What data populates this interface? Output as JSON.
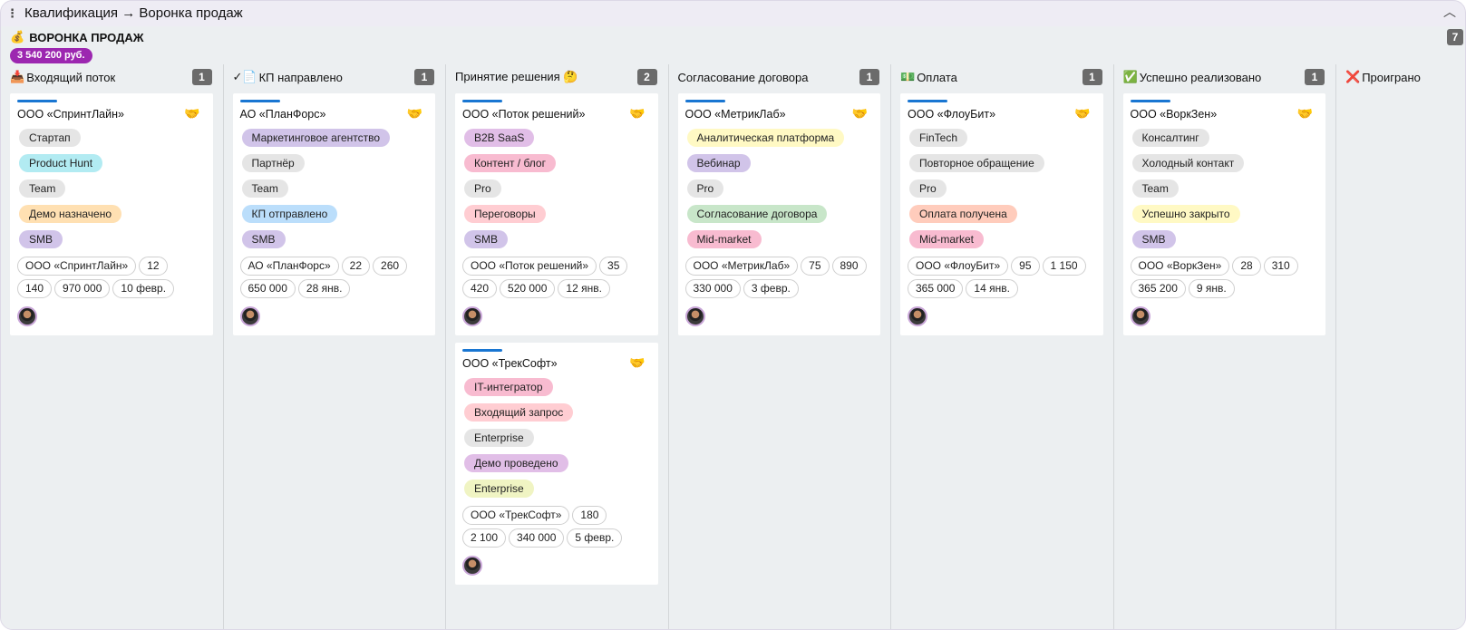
{
  "breadcrumb": "Квалификация → Воронка продаж",
  "board": {
    "icon": "money-bag-icon",
    "title": "ВОРОНКА ПРОДАЖ",
    "total": "3 540 200 руб.",
    "count": "7"
  },
  "colors": {
    "accent": "#1976d2",
    "total_badge": "#9c27b0",
    "count_badge": "#6b6b6b"
  },
  "columns": [
    {
      "icon": "📥",
      "title": "Входящий поток",
      "count": "1",
      "cards": [
        {
          "name": "ООО «СпринтЛайн»",
          "tags": [
            {
              "t": "Стартап",
              "c": "#e5e5e5"
            },
            {
              "t": "Product Hunt",
              "c": "#b2ebf2"
            },
            {
              "t": "Team",
              "c": "#e5e5e5"
            },
            {
              "t": "Демо назначено",
              "c": "#ffe0b2"
            },
            {
              "t": "SMB",
              "c": "#d1c4e9"
            }
          ],
          "chips": [
            "ООО «СпринтЛайн»",
            "12",
            "140",
            "970 000",
            "10 февр."
          ]
        }
      ]
    },
    {
      "icon": "✓📄",
      "title": "КП направлено",
      "count": "1",
      "cards": [
        {
          "name": "АО «ПланФорс»",
          "tags": [
            {
              "t": "Маркетинговое агентство",
              "c": "#d1c4e9"
            },
            {
              "t": "Партнёр",
              "c": "#e5e5e5"
            },
            {
              "t": "Team",
              "c": "#e5e5e5"
            },
            {
              "t": "КП отправлено",
              "c": "#bbdefb"
            },
            {
              "t": "SMB",
              "c": "#d1c4e9"
            }
          ],
          "chips": [
            "АО «ПланФорс»",
            "22",
            "260",
            "650 000",
            "28 янв."
          ]
        }
      ]
    },
    {
      "icon": "",
      "title": "Принятие решения 🤔",
      "count": "2",
      "cards": [
        {
          "name": "ООО «Поток решений»",
          "tags": [
            {
              "t": "B2B SaaS",
              "c": "#e1bee7"
            },
            {
              "t": "Контент / блог",
              "c": "#f8bbd0"
            },
            {
              "t": "Pro",
              "c": "#e5e5e5"
            },
            {
              "t": "Переговоры",
              "c": "#ffcdd2"
            },
            {
              "t": "SMB",
              "c": "#d1c4e9"
            }
          ],
          "chips": [
            "ООО «Поток решений»",
            "35",
            "420",
            "520 000",
            "12 янв."
          ]
        },
        {
          "name": "ООО «ТрекСофт»",
          "tags": [
            {
              "t": "IT-интегратор",
              "c": "#f8bbd0"
            },
            {
              "t": "Входящий запрос",
              "c": "#ffcdd2"
            },
            {
              "t": "Enterprise",
              "c": "#e5e5e5"
            },
            {
              "t": "Демо проведено",
              "c": "#e1bee7"
            },
            {
              "t": "Enterprise",
              "c": "#f0f4c3"
            }
          ],
          "chips": [
            "ООО «ТрекСофт»",
            "180",
            "2 100",
            "340 000",
            "5 февр."
          ]
        }
      ]
    },
    {
      "icon": "",
      "title": "Согласование договора",
      "count": "1",
      "cards": [
        {
          "name": "ООО «МетрикЛаб»",
          "tags": [
            {
              "t": "Аналитическая платформа",
              "c": "#fff9c4"
            },
            {
              "t": "Вебинар",
              "c": "#d1c4e9"
            },
            {
              "t": "Pro",
              "c": "#e5e5e5"
            },
            {
              "t": "Согласование договора",
              "c": "#c8e6c9"
            },
            {
              "t": "Mid-market",
              "c": "#f8bbd0"
            }
          ],
          "chips": [
            "ООО «МетрикЛаб»",
            "75",
            "890",
            "330 000",
            "3 февр."
          ]
        }
      ]
    },
    {
      "icon": "💵",
      "title": "Оплата",
      "count": "1",
      "cards": [
        {
          "name": "ООО «ФлоуБит»",
          "tags": [
            {
              "t": "FinTech",
              "c": "#e5e5e5"
            },
            {
              "t": "Повторное обращение",
              "c": "#e5e5e5"
            },
            {
              "t": "Pro",
              "c": "#e5e5e5"
            },
            {
              "t": "Оплата получена",
              "c": "#ffccbc"
            },
            {
              "t": "Mid-market",
              "c": "#f8bbd0"
            }
          ],
          "chips": [
            "ООО «ФлоуБит»",
            "95",
            "1 150",
            "365 000",
            "14 янв."
          ]
        }
      ]
    },
    {
      "icon": "✅",
      "title": "Успешно реализовано",
      "count": "1",
      "cards": [
        {
          "name": "ООО «ВоркЗен»",
          "tags": [
            {
              "t": "Консалтинг",
              "c": "#e5e5e5"
            },
            {
              "t": "Холодный контакт",
              "c": "#e5e5e5"
            },
            {
              "t": "Team",
              "c": "#e5e5e5"
            },
            {
              "t": "Успешно закрыто",
              "c": "#fff9c4"
            },
            {
              "t": "SMB",
              "c": "#d1c4e9"
            }
          ],
          "chips": [
            "ООО «ВоркЗен»",
            "28",
            "310",
            "365 200",
            "9 янв."
          ]
        }
      ]
    },
    {
      "icon": "❌",
      "title": "Проиграно",
      "count": "",
      "cards": []
    }
  ]
}
